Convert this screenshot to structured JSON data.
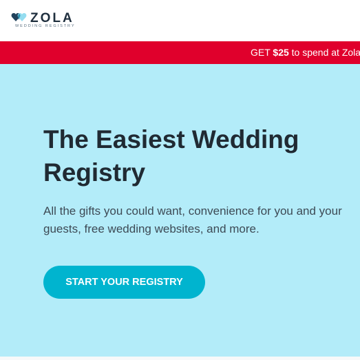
{
  "brand": {
    "name": "ZOLA",
    "tagline": "WEDDING REGISTRY",
    "colors": {
      "heart_dark": "#21425c",
      "heart_light": "#8ad9ee",
      "heart_mid": "#2a8fae"
    }
  },
  "promo": {
    "prefix": "GET",
    "amount": "$25",
    "suffix": "to spend at Zola",
    "background": "#e0002c"
  },
  "hero": {
    "title": "The Easiest Wedding Registry",
    "subtitle": "All the gifts you could want, convenience for you and your guests, free wedding websites, and more.",
    "cta_label": "START YOUR REGISTRY",
    "background": "#b3ecf9",
    "accent": "#00b4cf"
  }
}
